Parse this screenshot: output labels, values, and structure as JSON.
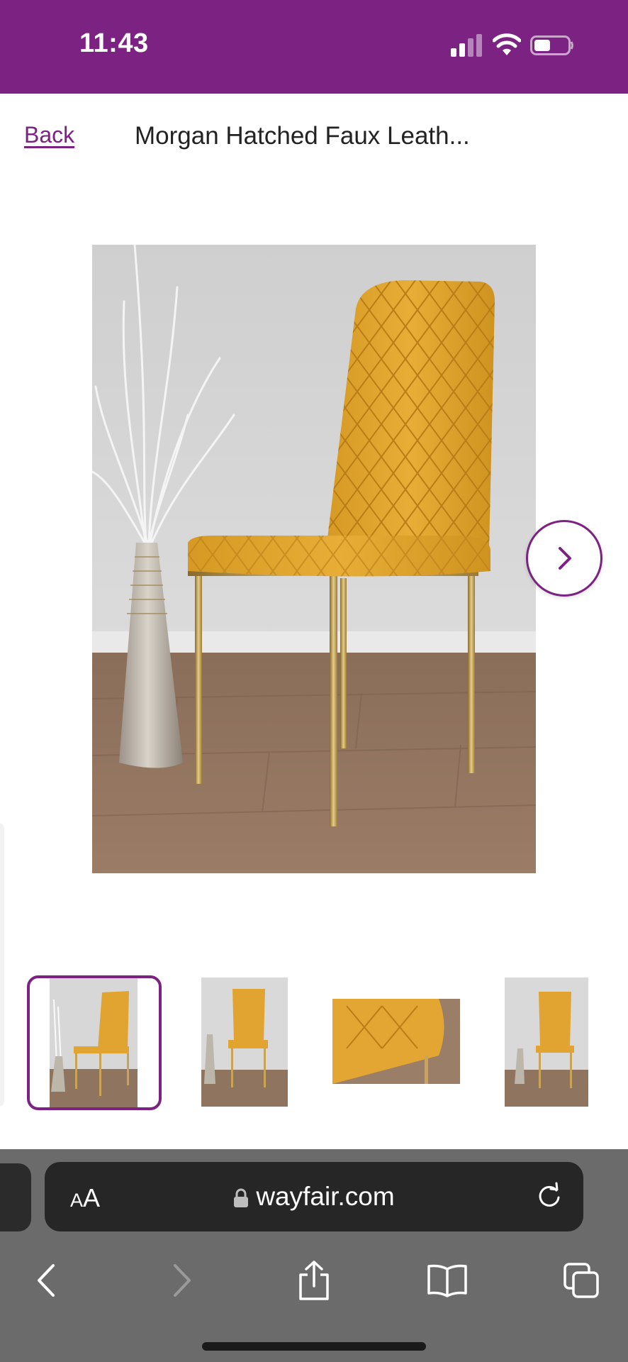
{
  "status_bar": {
    "time": "11:43",
    "background": "#7b2283"
  },
  "header": {
    "back_label": "Back",
    "title": "Morgan Hatched Faux Leath..."
  },
  "gallery": {
    "main_image": "Mustard yellow quilted faux leather dining chair with gold metal legs beside a silver vase of white branches on wooden floor",
    "next_icon": "chevron-right-icon",
    "thumbnails": [
      {
        "alt": "Chair side view with vase",
        "selected": true
      },
      {
        "alt": "Chair front angled view",
        "selected": false
      },
      {
        "alt": "Seat quilting close-up",
        "selected": false
      },
      {
        "alt": "Chair front view",
        "selected": false
      }
    ],
    "accent": "#7b2283"
  },
  "browser": {
    "text_size_label_small": "A",
    "text_size_label_large": "A",
    "url": "wayfair.com",
    "icons": {
      "lock": "lock-icon",
      "reload": "reload-icon",
      "back": "back-arrow-icon",
      "forward": "forward-arrow-icon",
      "share": "share-icon",
      "bookmarks": "bookmarks-icon",
      "tabs": "tabs-icon"
    }
  }
}
